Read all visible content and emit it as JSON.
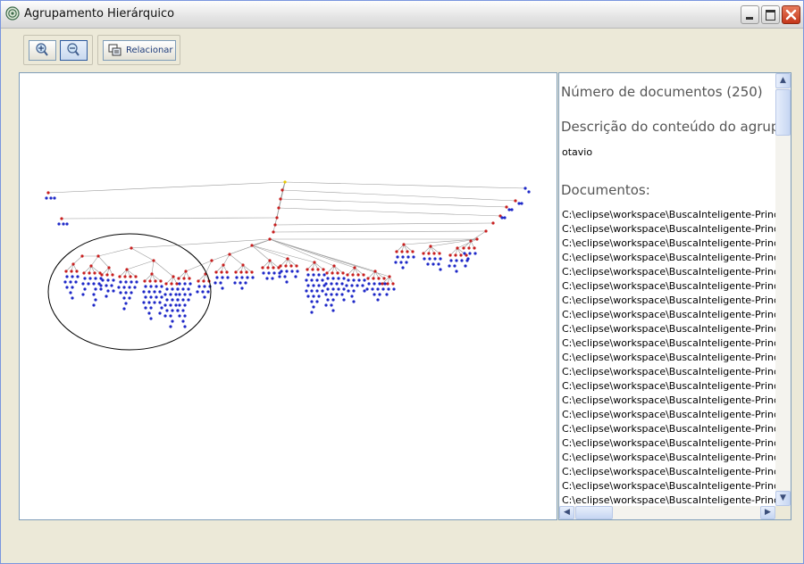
{
  "window": {
    "title": "Agrupamento Hierárquico",
    "icons": {
      "app": "app-icon",
      "minimize": "minimize-icon",
      "maximize": "maximize-icon",
      "close": "close-icon"
    }
  },
  "toolbar": {
    "zoom_in_icon": "zoom-in-icon",
    "zoom_out_icon": "zoom-out-icon",
    "relacionar_label": "Relacionar",
    "relacionar_icon": "relate-icon"
  },
  "colors": {
    "internal_node": "#C81E1E",
    "leaf_node": "#1E28C8",
    "root_node": "#E8C800",
    "edge": "#9A9A9A"
  },
  "info": {
    "document_count": "Número de documentos (250)",
    "description_heading": "Descrição do conteúdo do agrupan",
    "description_value": "otavio",
    "documents_heading": "Documentos:",
    "documents": [
      "C:\\eclipse\\workspace\\BuscaInteligente-Principal\\tr",
      "C:\\eclipse\\workspace\\BuscaInteligente-Principal\\tr",
      "C:\\eclipse\\workspace\\BuscaInteligente-Principal\\tr",
      "C:\\eclipse\\workspace\\BuscaInteligente-Principal\\tr",
      "C:\\eclipse\\workspace\\BuscaInteligente-Principal\\tr",
      "C:\\eclipse\\workspace\\BuscaInteligente-Principal\\tr",
      "C:\\eclipse\\workspace\\BuscaInteligente-Principal\\tr",
      "C:\\eclipse\\workspace\\BuscaInteligente-Principal\\tr",
      "C:\\eclipse\\workspace\\BuscaInteligente-Principal\\tr",
      "C:\\eclipse\\workspace\\BuscaInteligente-Principal\\tr",
      "C:\\eclipse\\workspace\\BuscaInteligente-Principal\\tr",
      "C:\\eclipse\\workspace\\BuscaInteligente-Principal\\tr",
      "C:\\eclipse\\workspace\\BuscaInteligente-Principal\\tr",
      "C:\\eclipse\\workspace\\BuscaInteligente-Principal\\tr",
      "C:\\eclipse\\workspace\\BuscaInteligente-Principal\\tr",
      "C:\\eclipse\\workspace\\BuscaInteligente-Principal\\tr",
      "C:\\eclipse\\workspace\\BuscaInteligente-Principal\\tr",
      "C:\\eclipse\\workspace\\BuscaInteligente-Principal\\tr",
      "C:\\eclipse\\workspace\\BuscaInteligente-Principal\\tr",
      "C:\\eclipse\\workspace\\BuscaInteligente-Principal\\tr",
      "C:\\eclipse\\workspace\\BuscaInteligente-Principal\\tr"
    ]
  },
  "scrollbars": {
    "up": "scroll-up-icon",
    "down": "scroll-down-icon",
    "left": "scroll-left-icon",
    "right": "scroll-right-icon"
  }
}
